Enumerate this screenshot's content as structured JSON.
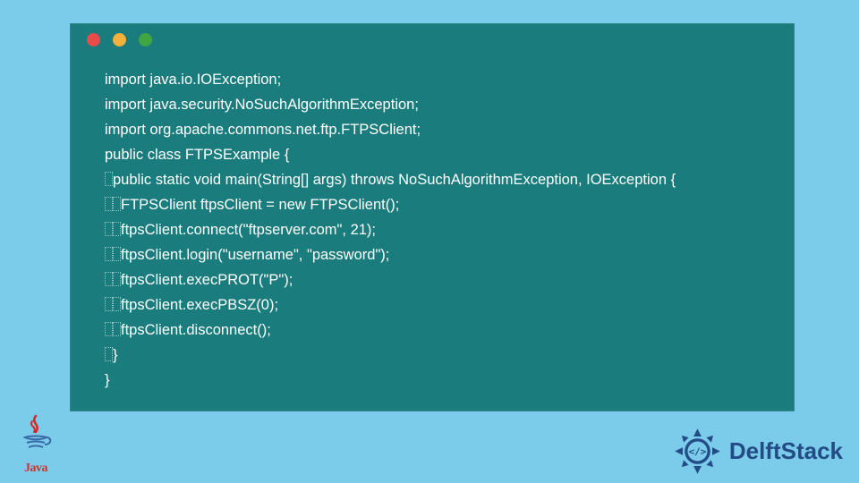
{
  "code": {
    "lines": [
      {
        "indent": 0,
        "text": "import java.io.IOException;"
      },
      {
        "indent": 0,
        "text": "import java.security.NoSuchAlgorithmException;"
      },
      {
        "indent": 0,
        "text": "import org.apache.commons.net.ftp.FTPSClient;"
      },
      {
        "indent": 0,
        "text": "public class FTPSExample {"
      },
      {
        "indent": 1,
        "text": "public static void main(String[] args) throws NoSuchAlgorithmException, IOException {"
      },
      {
        "indent": 2,
        "text": "FTPSClient ftpsClient = new FTPSClient();"
      },
      {
        "indent": 2,
        "text": "ftpsClient.connect(\"ftpserver.com\", 21);"
      },
      {
        "indent": 2,
        "text": "ftpsClient.login(\"username\", \"password\");"
      },
      {
        "indent": 2,
        "text": "ftpsClient.execPROT(\"P\");"
      },
      {
        "indent": 2,
        "text": "ftpsClient.execPBSZ(0);"
      },
      {
        "indent": 2,
        "text": "ftpsClient.disconnect();"
      },
      {
        "indent": 1,
        "text": "}"
      },
      {
        "indent": 0,
        "text": "}"
      }
    ]
  },
  "brand": {
    "name": "DelftStack"
  },
  "java_label": "Java"
}
